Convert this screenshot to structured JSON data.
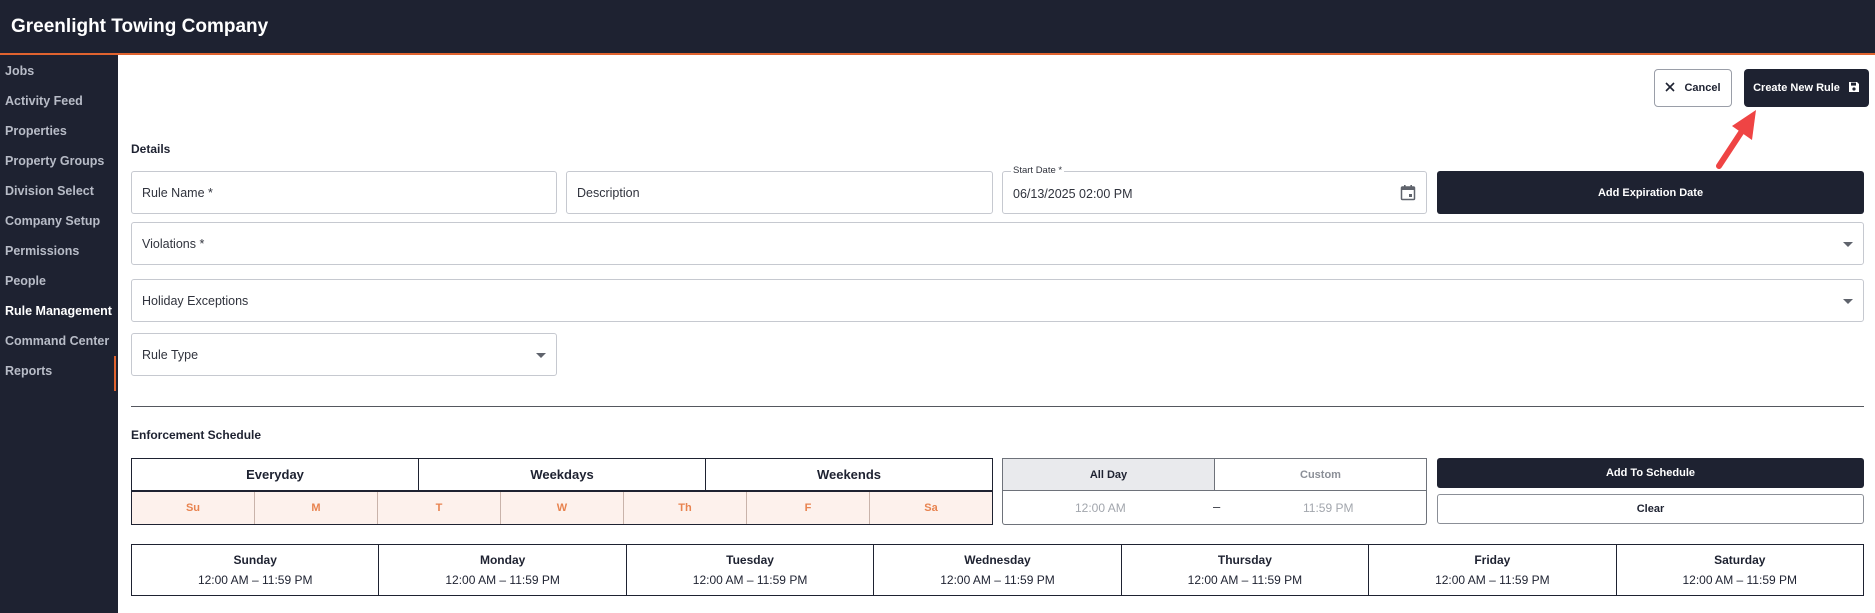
{
  "app": {
    "title": "Greenlight Towing Company"
  },
  "sidebar": {
    "items": [
      {
        "label": "Jobs"
      },
      {
        "label": "Activity Feed"
      },
      {
        "label": "Properties"
      },
      {
        "label": "Property Groups"
      },
      {
        "label": "Division Select"
      },
      {
        "label": "Company Setup"
      },
      {
        "label": "Permissions"
      },
      {
        "label": "People"
      },
      {
        "label": "Rule Management",
        "active": true
      },
      {
        "label": "Command Center"
      },
      {
        "label": "Reports"
      }
    ]
  },
  "toolbar": {
    "cancel_label": "Cancel",
    "create_label": "Create New Rule"
  },
  "details": {
    "heading": "Details",
    "rule_name_placeholder": "Rule Name *",
    "description_placeholder": "Description",
    "start_date_label": "Start Date *",
    "start_date_value": "06/13/2025 02:00 PM",
    "add_expiration_label": "Add Expiration Date",
    "violations_placeholder": "Violations *",
    "holiday_placeholder": "Holiday Exceptions",
    "rule_type_placeholder": "Rule Type"
  },
  "schedule": {
    "heading": "Enforcement Schedule",
    "presets": [
      "Everyday",
      "Weekdays",
      "Weekends"
    ],
    "days": [
      "Su",
      "M",
      "T",
      "W",
      "Th",
      "F",
      "Sa"
    ],
    "time_modes": [
      "All Day",
      "Custom"
    ],
    "selected_time_mode": "All Day",
    "time_from": "12:00 AM",
    "time_dash": "–",
    "time_to": "11:59 PM",
    "add_label": "Add To Schedule",
    "clear_label": "Clear",
    "week": [
      {
        "day": "Sunday",
        "range": "12:00 AM – 11:59 PM"
      },
      {
        "day": "Monday",
        "range": "12:00 AM – 11:59 PM"
      },
      {
        "day": "Tuesday",
        "range": "12:00 AM – 11:59 PM"
      },
      {
        "day": "Wednesday",
        "range": "12:00 AM – 11:59 PM"
      },
      {
        "day": "Thursday",
        "range": "12:00 AM – 11:59 PM"
      },
      {
        "day": "Friday",
        "range": "12:00 AM – 11:59 PM"
      },
      {
        "day": "Saturday",
        "range": "12:00 AM – 11:59 PM"
      }
    ]
  },
  "colors": {
    "navy": "#1e2231",
    "accent": "#e0632f",
    "day_text": "#e8834f",
    "day_bg": "#fdf1ec",
    "annotation_arrow": "#ef4444"
  },
  "icons": {
    "cancel": "close-icon",
    "create": "save-icon",
    "date": "calendar-icon",
    "dropdown": "chevron-down-icon"
  }
}
